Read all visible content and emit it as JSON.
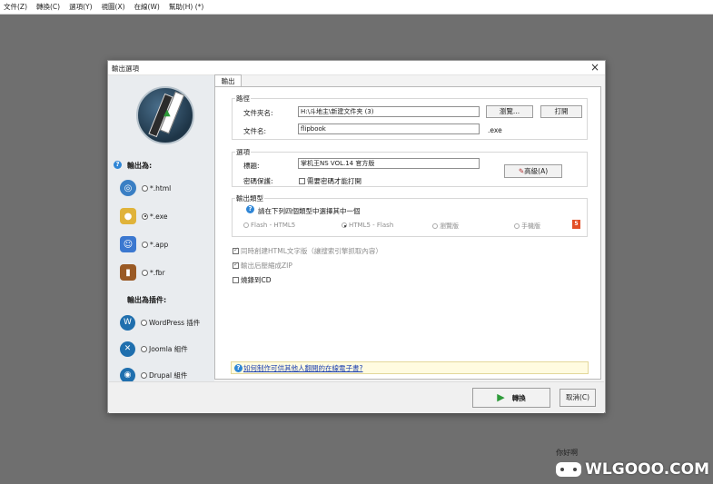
{
  "menubar": [
    "文件(Z)",
    "轉換(C)",
    "選項(Y)",
    "視圖(X)",
    "在線(W)",
    "幫助(H) (*)"
  ],
  "dialog": {
    "title": "輸出選項",
    "close_glyph": "×",
    "tab": "輸出",
    "left": {
      "output_as_label": "輸出為:",
      "formats": [
        {
          "label": "*.html",
          "selected": false,
          "icon": "globe-icon",
          "color": "#3a7fc4"
        },
        {
          "label": "*.exe",
          "selected": true,
          "icon": "lock-icon",
          "color": "#e0b33a"
        },
        {
          "label": "*.app",
          "selected": false,
          "icon": "mac-icon",
          "color": "#3b78d0"
        },
        {
          "label": "*.fbr",
          "selected": false,
          "icon": "book-icon",
          "color": "#9a5a25"
        }
      ],
      "plugins_label": "輸出為插件:",
      "plugins": [
        {
          "label": "WordPress 插件",
          "icon": "wordpress-icon"
        },
        {
          "label": "Joomla 組件",
          "icon": "joomla-icon"
        },
        {
          "label": "Drupal 組件",
          "icon": "drupal-icon"
        }
      ]
    },
    "path_group": {
      "title": "路徑",
      "folder_label": "文件夾名:",
      "folder_value": "H:\\斗地主\\新建文件夹 (3)",
      "browse_button": "瀏覽...",
      "open_button": "打開",
      "filename_label": "文件名:",
      "filename_value": "flipbook",
      "extension": ".exe"
    },
    "options_group": {
      "title": "選項",
      "title_label": "標題:",
      "title_value": "掌机王NS VOL.14 官方版",
      "advanced_button": "高級(A)",
      "password_label": "密碼保護:",
      "password_checkbox": "需要密碼才能打開"
    },
    "output_type_group": {
      "title": "輸出類型",
      "prompt": "請在下列四個類型中選擇其中一個",
      "options": [
        {
          "label": "Flash - HTML5",
          "selected": false
        },
        {
          "label": "HTML5 - Flash",
          "selected": true
        },
        {
          "label": "瀏覽版",
          "selected": false
        },
        {
          "label": "手機版",
          "selected": false
        }
      ],
      "html5_badge": "5"
    },
    "checks": {
      "html_text": "同時創建HTML文字版（讓搜索引擎抓取內容）",
      "zip": "輸出后壓縮成ZIP",
      "burn_cd": "燒錄到CD"
    },
    "info_link": "如何制作可供其他人翻閱的在線電子書?",
    "convert_button": "轉換",
    "cancel_button": "取消(C)"
  },
  "watermark": {
    "text": "WLGOOO.COM",
    "mark": "你好啊"
  }
}
